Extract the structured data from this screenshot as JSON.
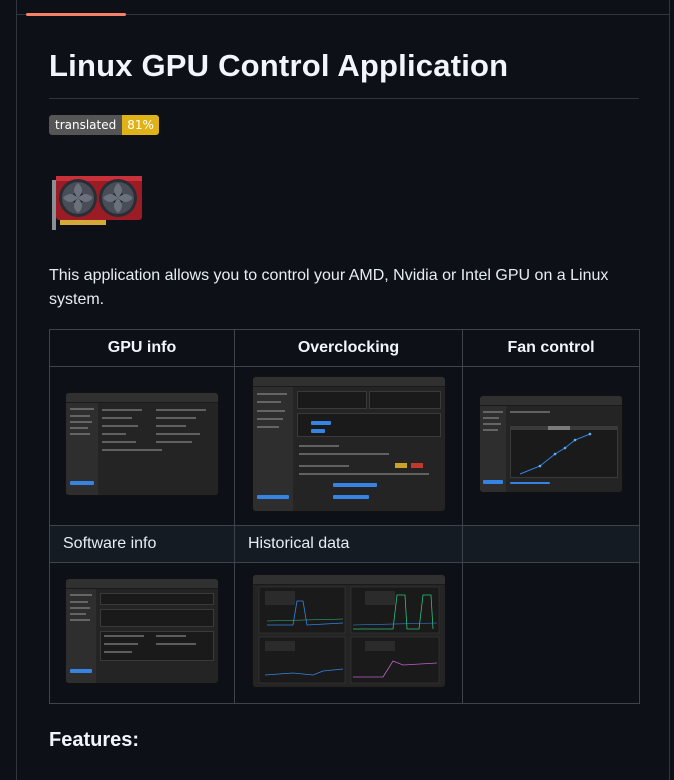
{
  "page": {
    "title": "Linux GPU Control Application",
    "badge": {
      "label": "translated",
      "value": "81%"
    },
    "intro": "This application allows you to control your AMD, Nvidia or Intel GPU on a Linux system.",
    "features_heading": "Features:"
  },
  "screenshots_table": {
    "headers": [
      "GPU info",
      "Overclocking",
      "Fan control"
    ],
    "second_row_labels": [
      "Software info",
      "Historical data",
      ""
    ],
    "thumbnails": [
      "gpu-info-screenshot",
      "overclocking-screenshot",
      "fan-control-screenshot",
      "software-info-screenshot",
      "historical-data-screenshot"
    ]
  },
  "colors": {
    "accent_rule": "#f78166",
    "badge_right": "#dfb317",
    "badge_left": "#555555",
    "app_blue": "#3584e4"
  }
}
